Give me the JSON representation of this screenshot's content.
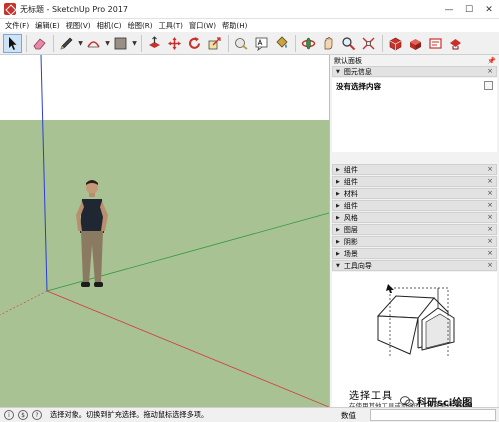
{
  "window": {
    "title": "无标题 - SketchUp Pro 2017",
    "controls": [
      "—",
      "☐",
      "✕"
    ]
  },
  "menu": [
    "文件(F)",
    "编辑(E)",
    "视图(V)",
    "相机(C)",
    "绘图(R)",
    "工具(T)",
    "窗口(W)",
    "帮助(H)"
  ],
  "toolbar": {
    "tools": [
      "select-arrow-icon",
      "eraser-icon",
      "pencil-line-icon",
      "arc-icon",
      "rectangle-icon",
      "push-pull-icon",
      "move-icon",
      "rotate-icon",
      "scale-icon",
      "tape-measure-icon",
      "text-icon",
      "paint-bucket-icon",
      "orbit-icon",
      "pan-icon",
      "zoom-icon",
      "zoom-extents-icon",
      "3d-warehouse-icon",
      "extension-warehouse-icon",
      "layout-icon",
      "extension-manager-icon"
    ]
  },
  "tray": {
    "title": "默认面板",
    "pin_icon": "pin-icon",
    "close": "×",
    "entity_info": {
      "label": "图元信息",
      "selection_text": "没有选择内容"
    },
    "panels": [
      "组件",
      "组件",
      "材料",
      "组件",
      "风格",
      "图层",
      "阴影",
      "场景"
    ],
    "instructor": {
      "label": "工具向导",
      "tool_title": "选择工具",
      "tool_desc": "在使用其他工具或命令时，选择要修改的图元。"
    }
  },
  "status": {
    "text": "选择对象。切换到扩充选择。拖动鼠标选择多项。",
    "measure_label": "数值",
    "measure_value": ""
  },
  "watermark": {
    "text": "科研sci绘图"
  },
  "colors": {
    "ground": "#a9c293",
    "sky": "#ffffff",
    "axis_blue": "#2a3fd0",
    "axis_red": "#d23a3a",
    "axis_green": "#2e9a3e"
  }
}
